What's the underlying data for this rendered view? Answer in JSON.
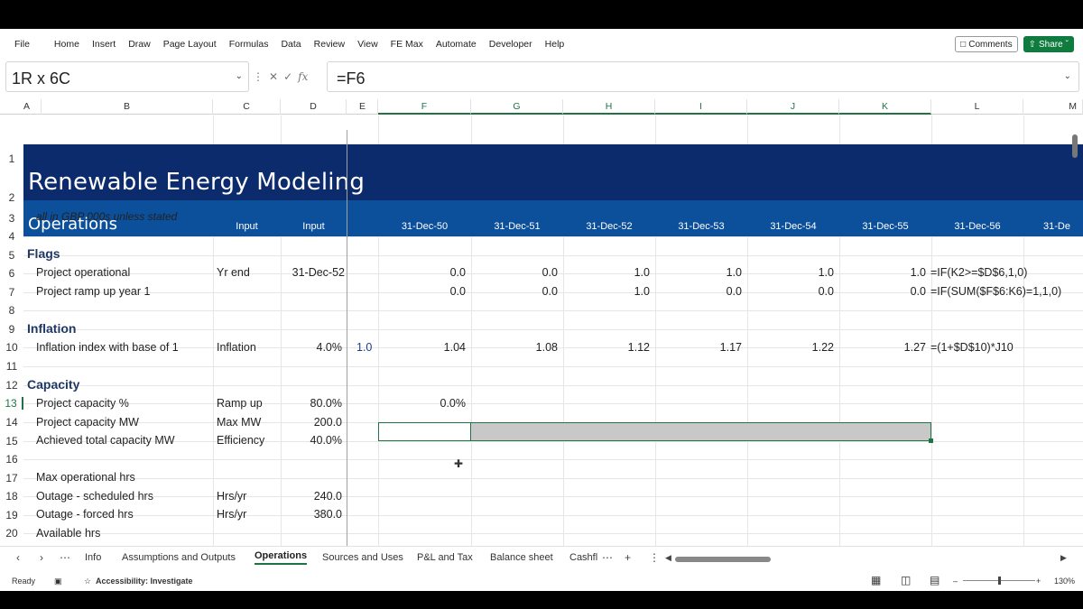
{
  "menu": [
    "File",
    "Home",
    "Insert",
    "Draw",
    "Page Layout",
    "Formulas",
    "Data",
    "Review",
    "View",
    "FE Max",
    "Automate",
    "Developer",
    "Help"
  ],
  "buttons": {
    "comments": "Comments",
    "share": "Share"
  },
  "namebox": "1R x 6C",
  "formula": "=F6",
  "fx_symbol": "fx",
  "columns": [
    "A",
    "B",
    "C",
    "D",
    "E",
    "F",
    "G",
    "H",
    "I",
    "J",
    "K",
    "L",
    "M"
  ],
  "sheet": {
    "title": "Renewable Energy Modeling",
    "subtitle": "Operations",
    "input_c": "Input",
    "input_d": "Input",
    "dates": [
      "31-Dec-50",
      "31-Dec-51",
      "31-Dec-52",
      "31-Dec-53",
      "31-Dec-54",
      "31-Dec-55",
      "31-Dec-56",
      "31-De"
    ],
    "r3": "all in GBP 000s unless stated",
    "r5": "Flags",
    "r6": {
      "label": "Project operational",
      "c": "Yr end",
      "d": "31-Dec-52",
      "vals": [
        "0.0",
        "0.0",
        "1.0",
        "1.0",
        "1.0",
        "1.0"
      ],
      "formula": "=IF(K2>=$D$6,1,0)"
    },
    "r7": {
      "label": "Project ramp up year 1",
      "vals": [
        "0.0",
        "0.0",
        "1.0",
        "0.0",
        "0.0",
        "0.0"
      ],
      "formula": "=IF(SUM($F$6:K6)=1,1,0)"
    },
    "r9": "Inflation",
    "r10": {
      "label": "Inflation index with base of 1",
      "c": "Inflation",
      "d": "4.0%",
      "e": "1.0",
      "vals": [
        "1.04",
        "1.08",
        "1.12",
        "1.17",
        "1.22",
        "1.27"
      ],
      "formula": "=(1+$D$10)*J10"
    },
    "r12": "Capacity",
    "r13": {
      "label": "Project capacity %",
      "c": "Ramp up",
      "d": "80.0%",
      "f": "0.0%"
    },
    "r14": {
      "label": "Project capacity MW",
      "c": "Max MW",
      "d": "200.0"
    },
    "r15": {
      "label": "Achieved total capacity MW",
      "c": "Efficiency",
      "d": "40.0%"
    },
    "r17": {
      "label": "Max operational hrs"
    },
    "r18": {
      "label": "Outage - scheduled hrs",
      "c": "Hrs/yr",
      "d": "240.0"
    },
    "r19": {
      "label": "Outage - forced hrs",
      "c": "Hrs/yr",
      "d": "380.0"
    },
    "r20": {
      "label": "Available hrs"
    }
  },
  "rows": [
    "1",
    "2",
    "3",
    "4",
    "5",
    "6",
    "7",
    "8",
    "9",
    "10",
    "11",
    "12",
    "13",
    "14",
    "15",
    "16",
    "17",
    "18",
    "19",
    "20"
  ],
  "tabs": [
    "Info",
    "Assumptions and Outputs",
    "Operations",
    "Sources and Uses",
    "P&L and Tax",
    "Balance sheet",
    "Cashfl"
  ],
  "status": {
    "ready": "Ready",
    "accessibility": "Accessibility: Investigate",
    "zoom": "130%"
  }
}
